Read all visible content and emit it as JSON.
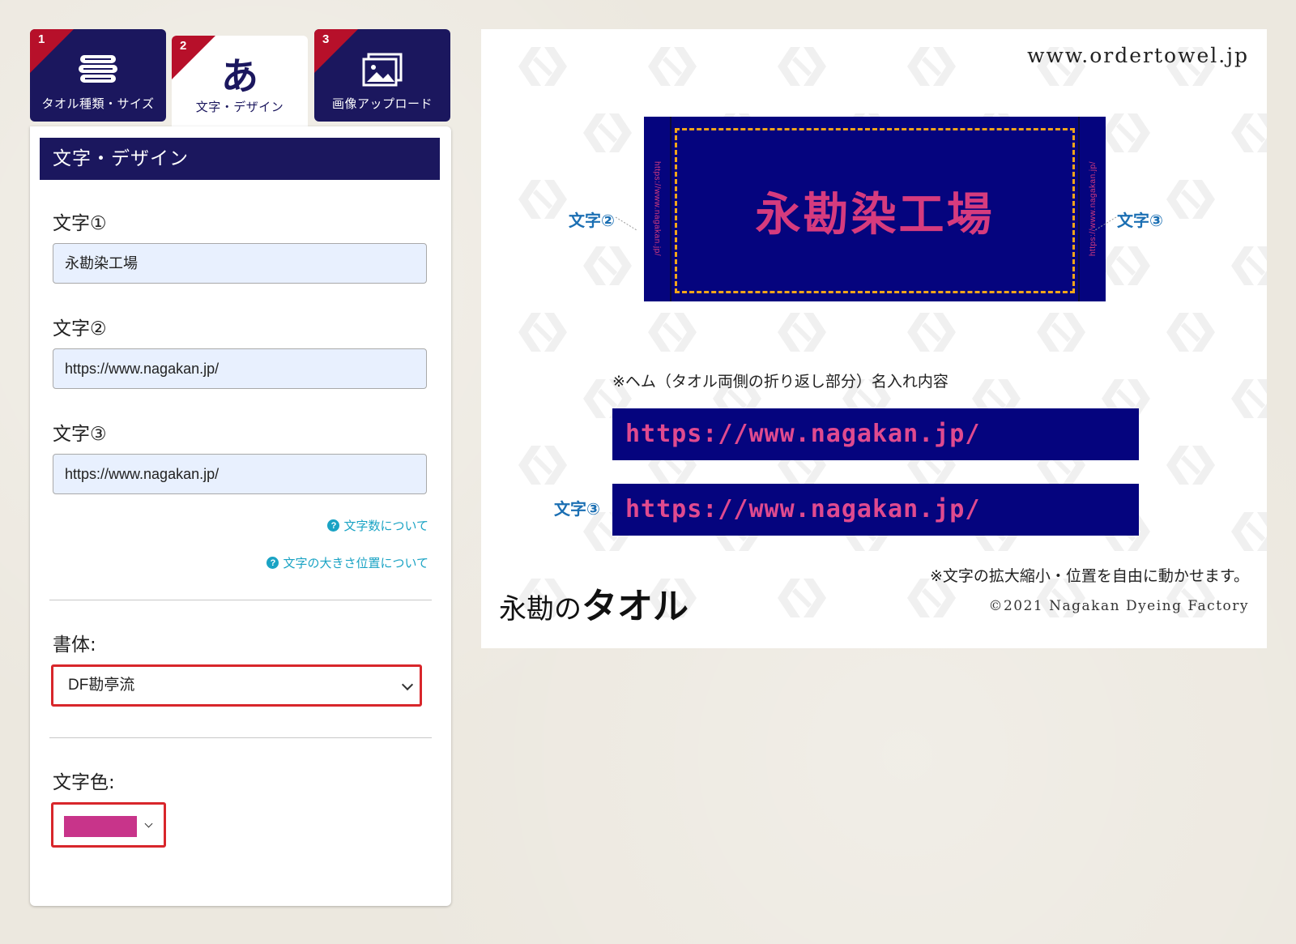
{
  "tabs": [
    {
      "num": "1",
      "label": "タオル種類・サイズ",
      "icon": "towel-stack-icon"
    },
    {
      "num": "2",
      "label": "文字・デザイン",
      "glyph": "あ",
      "icon": "hiragana-a-icon"
    },
    {
      "num": "3",
      "label": "画像アップロード",
      "icon": "image-icon"
    }
  ],
  "panel": {
    "header": "文字・デザイン",
    "text1": {
      "label": "文字①",
      "value": "永勘染工場"
    },
    "text2": {
      "label": "文字②",
      "value": "https://www.nagakan.jp/"
    },
    "text3": {
      "label": "文字③",
      "value": "https://www.nagakan.jp/"
    },
    "help_char_count": "文字数について",
    "help_size_position": "文字の大きさ位置について",
    "font": {
      "label": "書体:",
      "selected": "DF勘亭流"
    },
    "color": {
      "label": "文字色:",
      "selected": "#c8348a"
    }
  },
  "preview": {
    "site_url": "www.ordertowel.jp",
    "towel_main_text": "永勘染工場",
    "towel_left_vertical": "https://www.nagakan.jp/",
    "towel_right_vertical": "https://www.nagakan.jp/",
    "label_text2": "文字②",
    "label_text3": "文字③",
    "hem_note": "※ヘム（タオル両側の折り返し部分）名入れ内容",
    "hem_bar1": "https://www.nagakan.jp/",
    "hem_bar2": "https://www.nagakan.jp/",
    "hem_bar2_label": "文字③",
    "movable_note": "※文字の拡大縮小・位置を自由に動かせます。",
    "brand_small": "永勘の",
    "brand_big": "タオル",
    "copyright": "©2021 Nagakan Dyeing Factory"
  },
  "colors": {
    "navy": "#1b175e",
    "towel": "#05047e",
    "accent_red": "#b7102a",
    "text_pink": "#d63b7e",
    "link": "#1aa3c4"
  }
}
